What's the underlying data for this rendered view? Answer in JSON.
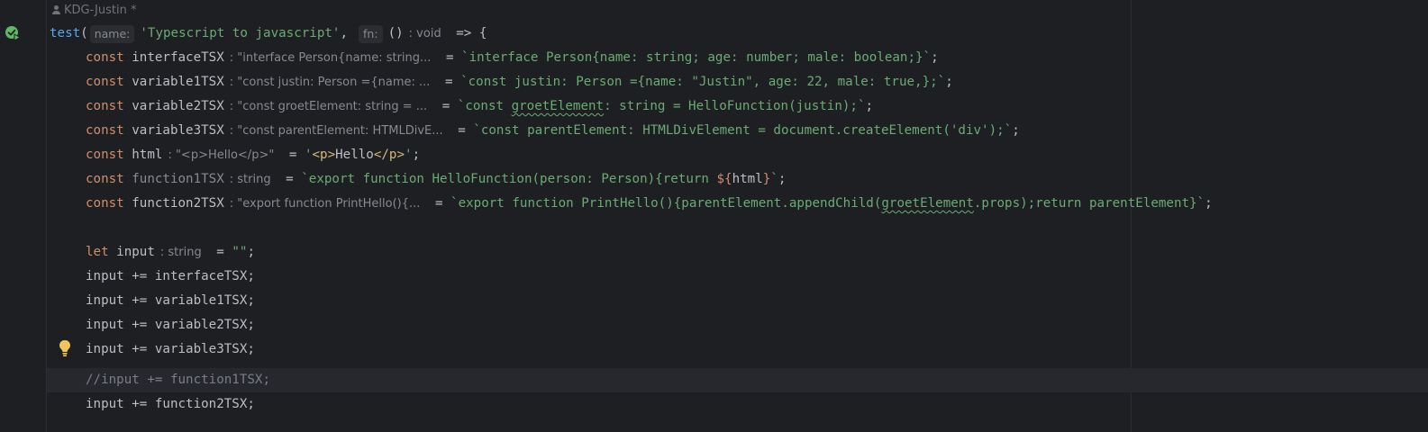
{
  "author": {
    "name": "KDG-Justin *"
  },
  "colors": {
    "background": "#1e1f22",
    "keyword": "#cf8e6d",
    "function": "#56a8f5",
    "string": "#6aab73",
    "hint": "#868a91"
  },
  "icons": {
    "run": "run-test-icon",
    "bulb": "lightbulb-icon",
    "author": "person-icon"
  },
  "code": {
    "l1": {
      "fn": "test",
      "p1": "(",
      "hint_name": "name:",
      "str": "'Typescript to javascript'",
      "comma": ",",
      "hint_fn": "fn:",
      "paren": "()",
      "hint_void": ": void",
      "arrow": " => {"
    },
    "l2": {
      "kw": "const",
      "name": "interfaceTSX",
      "hint": ": \"interface Person{name: string...",
      "eq": " = ",
      "str": "`interface Person{name: string; age: number; male: boolean;}`",
      "semi": ";"
    },
    "l3": {
      "kw": "const",
      "name": "variable1TSX",
      "hint": ": \"const justin: Person ={name: ...",
      "eq": " = ",
      "str": "`const justin: Person ={name: \"Justin\", age: 22, male: true,};`",
      "semi": ";"
    },
    "l4": {
      "kw": "const",
      "name": "variable2TSX",
      "hint": ": \"const groetElement: string = ...",
      "eq": " = ",
      "str_a": "`const ",
      "str_b": "groetElement",
      "str_c": ": string = HelloFunction(justin);`",
      "semi": ";"
    },
    "l5": {
      "kw": "const",
      "name": "variable3TSX",
      "hint": ": \"const parentElement: HTMLDivE...",
      "eq": " = ",
      "str": "`const parentElement: HTMLDivElement = document.createElement('div');`",
      "semi": ";"
    },
    "l6": {
      "kw": "const",
      "name": "html",
      "hint": ": \"<p>Hello</p>\"",
      "eq": " = ",
      "q1": "'",
      "t1": "<p>",
      "txt": "Hello",
      "t2": "</p>",
      "q2": "'",
      "semi": ";"
    },
    "l7": {
      "kw": "const",
      "name": "function1TSX",
      "hint": ": string",
      "eq": " = ",
      "str_a": "`export function HelloFunction(person: Person){return ",
      "interp_a": "${",
      "interp_v": "html",
      "interp_b": "}",
      "str_b": "`",
      "semi": ";"
    },
    "l8": {
      "kw": "const",
      "name": "function2TSX",
      "hint": ": \"export function PrintHello(){...",
      "eq": " = ",
      "str_a": "`export function PrintHello(){parentElement.appendChild(",
      "str_b": "groetElement",
      "str_c": ".props);return parentElement}`",
      "semi": ";"
    },
    "l10": {
      "kw": "let",
      "name": "input",
      "hint": ": string",
      "eq": " = ",
      "str": "\"\"",
      "semi": ";"
    },
    "l11": "input += interfaceTSX;",
    "l12": "input += variable1TSX;",
    "l13": "input += variable2TSX;",
    "l14": "input += variable3TSX;",
    "l15": "//input += function1TSX;",
    "l16": "input += function2TSX;"
  }
}
